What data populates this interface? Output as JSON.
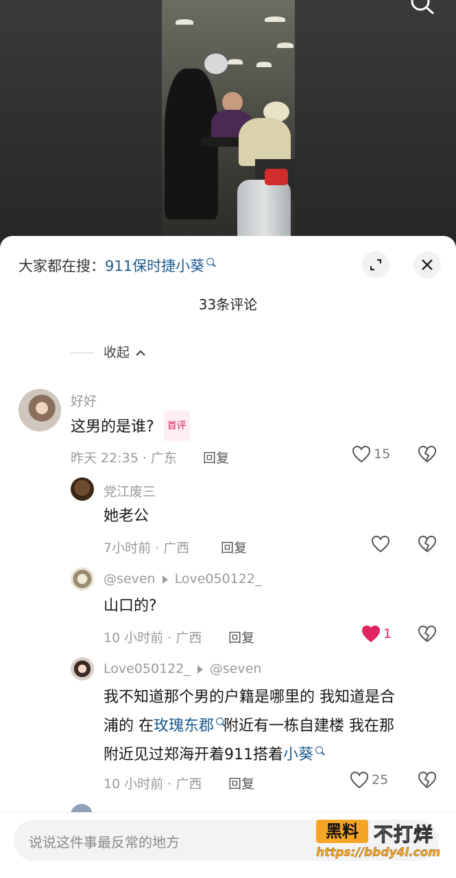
{
  "sheet": {
    "search_prefix": "大家都在搜：",
    "search_term": "911保时捷小葵",
    "comment_count": "33条评论",
    "collapse_label": "收起"
  },
  "comments": [
    {
      "username": "好好",
      "text": "这男的是谁?",
      "badge": "首评",
      "meta": "昨天 22:35 · 广东",
      "reply": "回复",
      "likes": "15"
    },
    {
      "username": "党江废三",
      "text": "她老公",
      "meta": "7小时前 · 广西",
      "reply": "回复",
      "likes": ""
    },
    {
      "username": "@seven",
      "reply_to": "Love050122_",
      "text": "山口的?",
      "meta": "10 小时前 · 广西",
      "reply": "回复",
      "likes": "1",
      "liked": true
    },
    {
      "username": "Love050122_",
      "reply_to": "@seven",
      "text_line1": "我不知道那个男的户籍是哪里的 我知道是合",
      "text_line2_a": "浦的 在",
      "text_line2_link": "玫瑰东郡",
      "text_line2_b": "附近有一栋自建楼 我在那",
      "text_line3_a": "附近见过郑海开着911搭着",
      "text_line3_link": "小葵",
      "meta": "10 小时前 · 广西",
      "reply": "回复",
      "likes": "25"
    }
  ],
  "input": {
    "placeholder": "说说这件事最反常的地方"
  },
  "watermark": {
    "box_text": "黑料",
    "right_text": "不打烊",
    "url": "https://bbdy4l.com"
  },
  "colors": {
    "link": "#1c5a8f",
    "liked": "#e0245e",
    "watermark": "#f5a524"
  }
}
